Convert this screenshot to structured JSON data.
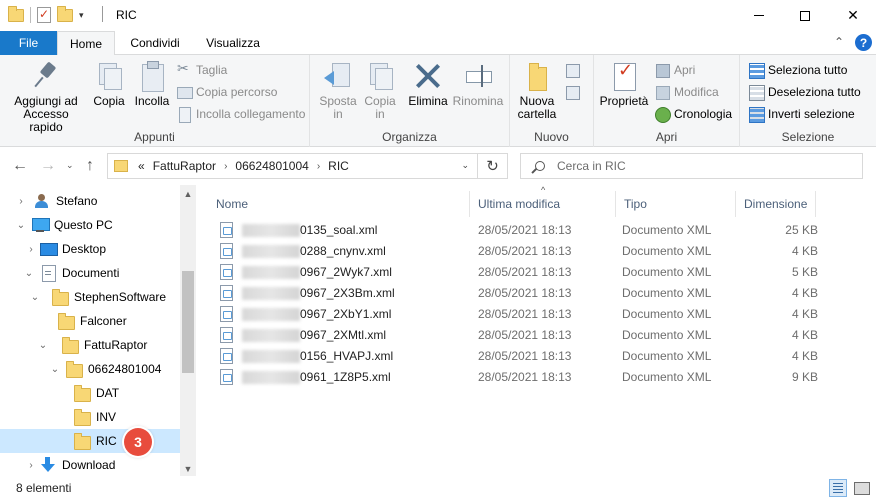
{
  "window": {
    "title": "RIC",
    "minimize_icon": "minimize-icon",
    "maximize_icon": "maximize-icon",
    "close_icon": "close-icon"
  },
  "tabs": {
    "file": "File",
    "home": "Home",
    "share": "Condividi",
    "view": "Visualizza"
  },
  "ribbon": {
    "appunti": {
      "label": "Appunti",
      "pin": "Aggiungi ad Accesso rapido",
      "copy": "Copia",
      "paste": "Incolla",
      "cut": "Taglia",
      "copy_path": "Copia percorso",
      "paste_link": "Incolla collegamento"
    },
    "organizza": {
      "label": "Organizza",
      "move_to_1": "Sposta",
      "move_to_2": "in",
      "copy_to_1": "Copia",
      "copy_to_2": "in",
      "delete": "Elimina",
      "rename": "Rinomina"
    },
    "nuovo": {
      "label": "Nuovo",
      "new_folder_1": "Nuova",
      "new_folder_2": "cartella"
    },
    "apri": {
      "label": "Apri",
      "properties": "Proprietà",
      "open": "Apri",
      "modify": "Modifica",
      "history": "Cronologia"
    },
    "selezione": {
      "label": "Selezione",
      "select_all": "Seleziona tutto",
      "select_none": "Deseleziona tutto",
      "invert": "Inverti selezione"
    }
  },
  "address": {
    "overflow": "«",
    "segments": [
      "FattuRaptor",
      "06624801004",
      "RIC"
    ]
  },
  "search": {
    "placeholder": "Cerca in RIC"
  },
  "nav_tree": [
    {
      "label": "Stefano",
      "icon": "user-icon",
      "chevron": "›"
    },
    {
      "label": "Questo PC",
      "icon": "pc-icon",
      "chevron": "⌄"
    },
    {
      "label": "Desktop",
      "icon": "desktop-icon",
      "chevron": "›"
    },
    {
      "label": "Documenti",
      "icon": "documents-icon",
      "chevron": "⌄"
    },
    {
      "label": "StephenSoftware",
      "icon": "folder-icon",
      "chevron": "⌄"
    },
    {
      "label": "Falconer",
      "icon": "folder-icon",
      "chevron": ""
    },
    {
      "label": "FattuRaptor",
      "icon": "folder-icon",
      "chevron": "⌄"
    },
    {
      "label": "06624801004",
      "icon": "folder-icon",
      "chevron": "⌄"
    },
    {
      "label": "DAT",
      "icon": "folder-icon",
      "chevron": ""
    },
    {
      "label": "INV",
      "icon": "folder-icon",
      "chevron": ""
    },
    {
      "label": "RIC",
      "icon": "folder-icon",
      "chevron": "",
      "selected": true
    },
    {
      "label": "Download",
      "icon": "download-icon",
      "chevron": "›"
    }
  ],
  "badge": "3",
  "columns": {
    "name": "Nome",
    "modified": "Ultima modifica",
    "type": "Tipo",
    "size": "Dimensione"
  },
  "files": [
    {
      "name": "0135_soal.xml",
      "modified": "28/05/2021 18:13",
      "type": "Documento XML",
      "size": "25 KB"
    },
    {
      "name": "0288_cnynv.xml",
      "modified": "28/05/2021 18:13",
      "type": "Documento XML",
      "size": "4 KB"
    },
    {
      "name": "0967_2Wyk7.xml",
      "modified": "28/05/2021 18:13",
      "type": "Documento XML",
      "size": "5 KB"
    },
    {
      "name": "0967_2X3Bm.xml",
      "modified": "28/05/2021 18:13",
      "type": "Documento XML",
      "size": "4 KB"
    },
    {
      "name": "0967_2XbY1.xml",
      "modified": "28/05/2021 18:13",
      "type": "Documento XML",
      "size": "4 KB"
    },
    {
      "name": "0967_2XMtl.xml",
      "modified": "28/05/2021 18:13",
      "type": "Documento XML",
      "size": "4 KB"
    },
    {
      "name": "0156_HVAPJ.xml",
      "modified": "28/05/2021 18:13",
      "type": "Documento XML",
      "size": "4 KB"
    },
    {
      "name": "0961_1Z8P5.xml",
      "modified": "28/05/2021 18:13",
      "type": "Documento XML",
      "size": "9 KB"
    }
  ],
  "status": {
    "count": "8 elementi"
  },
  "colors": {
    "file_tab": "#1979ca",
    "selection": "#cce8ff",
    "badge": "#e84c3d"
  }
}
